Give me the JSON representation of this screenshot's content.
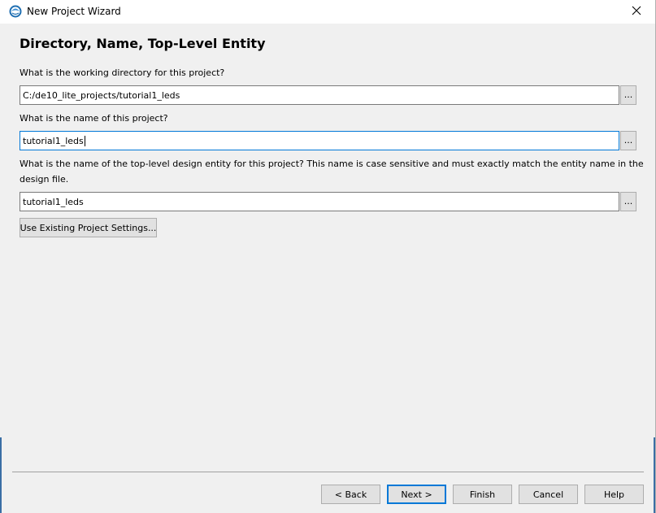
{
  "window": {
    "title": "New Project Wizard",
    "close_glyph": "✕"
  },
  "page": {
    "heading": "Directory, Name, Top-Level Entity"
  },
  "fields": {
    "directory": {
      "label": "What is the working directory for this project?",
      "value": "C:/de10_lite_projects/tutorial1_leds",
      "browse_label": "..."
    },
    "project_name": {
      "label": "What is the name of this project?",
      "value": "tutorial1_leds",
      "browse_label": "..."
    },
    "top_level_entity": {
      "label_line1": "What is the name of the top-level design entity for this project? This name is case sensitive and must exactly match the entity name in the",
      "label_line2": "design file.",
      "value": "tutorial1_leds",
      "browse_label": "..."
    }
  },
  "buttons": {
    "use_existing": "Use Existing Project Settings...",
    "back": "< Back",
    "next": "Next >",
    "finish": "Finish",
    "cancel": "Cancel",
    "help": "Help"
  },
  "icons": {
    "app": "quartus-globe-icon",
    "close": "close-icon"
  }
}
